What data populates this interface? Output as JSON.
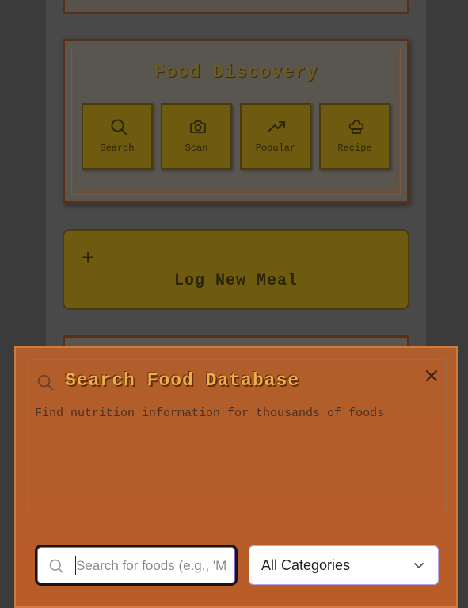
{
  "discovery": {
    "title": "Food Discovery",
    "tiles": [
      {
        "label": "Search",
        "icon": "search-icon"
      },
      {
        "label": "Scan",
        "icon": "camera-icon"
      },
      {
        "label": "Popular",
        "icon": "trending-up-icon"
      },
      {
        "label": "Recipe",
        "icon": "chef-hat-icon"
      }
    ]
  },
  "log_meal": {
    "plus": "+",
    "label": "Log New Meal"
  },
  "modal": {
    "title": "Search Food Database",
    "description": "Find nutrition information for thousands of foods",
    "search": {
      "placeholder": "Search for foods (e.g., 'M",
      "value": ""
    },
    "category": {
      "selected": "All Categories"
    }
  },
  "colors": {
    "modal_bg": "#b55d2a",
    "title_gold": "#e8b14a",
    "tile_bg": "#6e5b0f"
  }
}
